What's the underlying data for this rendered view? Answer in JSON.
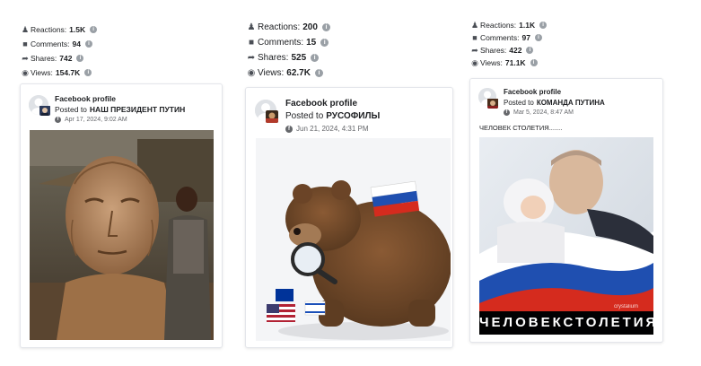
{
  "posts": [
    {
      "stats": {
        "reactions_label": "Reactions:",
        "reactions": "1.5K",
        "comments_label": "Comments:",
        "comments": "94",
        "shares_label": "Shares:",
        "shares": "742",
        "views_label": "Views:",
        "views": "154.7K"
      },
      "profile": "Facebook profile",
      "posted_prefix": "Posted to",
      "page_name": "НАШ ПРЕЗИДЕНТ ПУТИН",
      "date": "Apr 17, 2024, 9:02 AM",
      "caption": "",
      "overlay_text": ""
    },
    {
      "stats": {
        "reactions_label": "Reactions:",
        "reactions": "200",
        "comments_label": "Comments:",
        "comments": "15",
        "shares_label": "Shares:",
        "shares": "525",
        "views_label": "Views:",
        "views": "62.7K"
      },
      "profile": "Facebook profile",
      "posted_prefix": "Posted to",
      "page_name": "РУСОФИЛЫ",
      "date": "Jun 21, 2024, 4:31 PM",
      "caption": "",
      "overlay_text": ""
    },
    {
      "stats": {
        "reactions_label": "Reactions:",
        "reactions": "1.1K",
        "comments_label": "Comments:",
        "comments": "97",
        "shares_label": "Shares:",
        "shares": "422",
        "views_label": "Views:",
        "views": "71.1K"
      },
      "profile": "Facebook profile",
      "posted_prefix": "Posted to",
      "page_name": "КОМАНДА ПУТИНА",
      "date": "Mar 5, 2024, 8:47 AM",
      "caption": "ЧЕЛОВЕК СТОЛЕТИЯ.......",
      "overlay_text": "ЧЕЛОВЕКСТОЛЕТИЯ"
    }
  ],
  "icons": {
    "reactions": "reactions-icon",
    "comments": "comment-icon",
    "shares": "share-icon",
    "views": "eye-icon",
    "info": "info-icon",
    "privacy": "globe-icon"
  },
  "colors": {
    "info_badge": "#9aa0a6",
    "text": "#1c1e21",
    "muted": "#65676b"
  }
}
